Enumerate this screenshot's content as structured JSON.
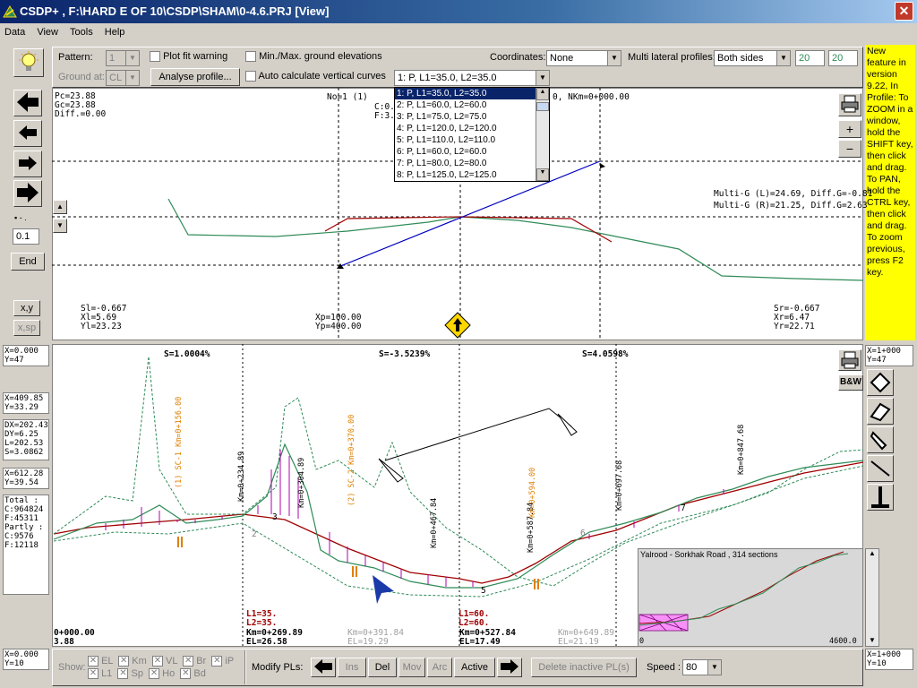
{
  "window": {
    "title": "CSDP+ , F:\\HARD E OF 10\\CSDP\\SHAM\\0-4.6.PRJ [View]",
    "close": "✕"
  },
  "menu": [
    "Data",
    "View",
    "Tools",
    "Help"
  ],
  "toolbar": {
    "pattern_label": "Pattern:",
    "pattern_value": "1",
    "ground_label": "Ground at:",
    "ground_value": "CL",
    "plot_fit_label": "Plot fit warning",
    "analyse_label": "Analyse profile...",
    "minmax_label": "Min./Max. ground elevations",
    "auto_vc_label": "Auto calculate vertical curves",
    "coordinates_label": "Coordinates:",
    "coordinates_value": "None",
    "multi_lat_label": "Multi lateral profiles:",
    "multi_lat_value": "Both sides",
    "multi_lat_left": "20",
    "multi_lat_right": "20",
    "profile_select": "1: P, L1=35.0, L2=35.0"
  },
  "dropdown": [
    "1: P, L1=35.0, L2=35.0",
    "2: P, L1=60.0, L2=60.0",
    "3: P, L1=75.0, L2=75.0",
    "4: P, L1=120.0, L2=120.0",
    "5: P, L1=110.0, L2=110.0",
    "6: P, L1=60.0, L2=60.0",
    "7: P, L1=80.0, L2=80.0",
    "8: P, L1=125.0, L2=125.0"
  ],
  "note": "New feature in version 9.22, In Profile: To ZOOM in a window, hold the SHIFT key, then click and drag. To PAN, hold the CTRL key, then click and drag. To zoom previous, press F2 key.",
  "cross": {
    "pc": "Pc=23.88",
    "gc": "Gc=23.88",
    "diff": "Diff.=0.00",
    "no": "No=1 (1)",
    "c": "C:0.",
    "f": "F:3.8",
    "nkm": "0, NKm=0+000.00",
    "multi_l": "Multi-G (L)=24.69, Diff.G=-0.81",
    "multi_r": "Multi-G (R)=21.25, Diff.G=2.63",
    "sl": "Sl=-0.667",
    "xl": "Xl=5.69",
    "yl": "Yl=23.23",
    "xp": "Xp=100.00",
    "yp": "Yp=400.00",
    "sr": "Sr=-0.667",
    "xr": "Xr=6.47",
    "yr": "Yr=22.71"
  },
  "left_tools": {
    "step_value": "0.1",
    "end": "End",
    "xy": "x,y",
    "xsp": "x,sp"
  },
  "left_info": {
    "b1x": "X=0.000",
    "b1y": "Y=47",
    "b2x": "X=409.85",
    "b2y": "Y=33.29",
    "dx": "DX=202.43",
    "dy": "DY=6.25",
    "l": "L=202.53",
    "s": "S=3.0862",
    "b4x": "X=612.28",
    "b4y": "Y=39.54",
    "total": "Total :",
    "tc": "C:964824",
    "tf": "F:45311",
    "partly": "Partly :",
    "pc": "C:9576",
    "pf": "F:12118",
    "bx": "X=0.000",
    "by": "Y=10"
  },
  "right_info": {
    "tx": "X=1+000",
    "ty": "Y=47",
    "bx": "X=1+000",
    "by": "Y=10",
    "bw": "B&W"
  },
  "profile": {
    "s1": "S=1.0004%",
    "s2": "S=-3.5239%",
    "s3": "S=4.0598%",
    "km1": "Km=0+234.89",
    "km2": "Km=0+304.89",
    "km3": "Km=0+467.84",
    "km4": "Km=0+587.84",
    "km5": "Km=0+697.68",
    "km6": "Km=0+847.68",
    "sc1": "(1) SC-1  Km=0+156.00",
    "sc2": "(2) SC-2  Km=0+370.00",
    "sc3": "Km=0+594.00",
    "pl1": "L1=35.",
    "pl2": "L2=35.",
    "pl3": "L1=60.",
    "pl4": "L2=60.",
    "b1": "Km=0+269.89",
    "b1e": "EL=26.58",
    "b2": "Km=0+391.84",
    "b2e": "EL=19.29",
    "b3": "Km=0+527.84",
    "b3e": "EL=17.49",
    "b4": "Km=0+649.89",
    "b4e": "EL=21.19",
    "st0": "0+000.00",
    "st0e": "3.88",
    "n2": "2",
    "n3": "3",
    "n5": "5",
    "n6": "6",
    "n7": "7"
  },
  "minimap": {
    "title": "Yalrood - Sorkhak Road",
    "sections": ",   314 sections",
    "start": "0",
    "end": "4600.0"
  },
  "bottom": {
    "show": "Show:",
    "el": "EL",
    "km": "Km",
    "vl": "VL",
    "br": "Br",
    "ip": "iP",
    "l1": "L1",
    "sp": "Sp",
    "ho": "Ho",
    "bd": "Bd",
    "modify": "Modify PLs:",
    "ins": "Ins",
    "del": "Del",
    "mov": "Mov",
    "arc": "Arc",
    "active": "Active",
    "delete_inactive": "Delete inactive PL(s)",
    "speed": "Speed :",
    "speed_value": "80"
  }
}
